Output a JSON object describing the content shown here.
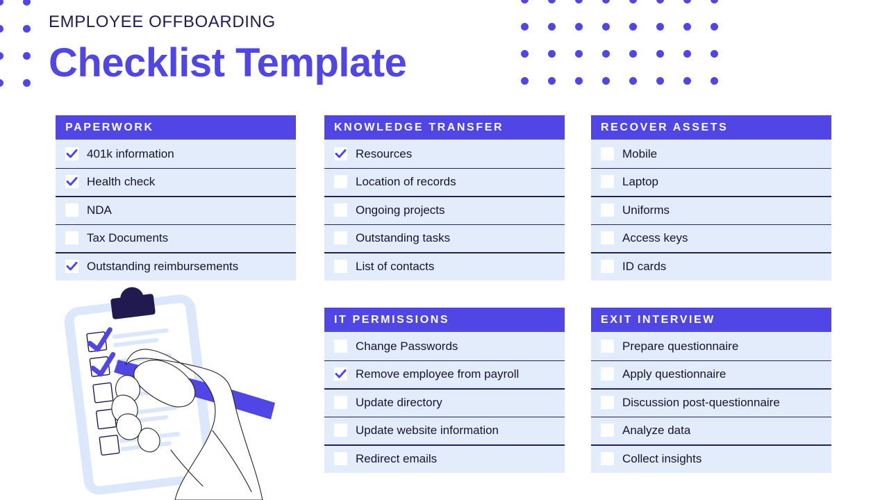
{
  "header": {
    "eyebrow": "EMPLOYEE OFFBOARDING",
    "title": "Checklist Template"
  },
  "colors": {
    "accent_purple": "#4f46e5",
    "row_background": "#e3ecfb",
    "row_divider": "#23215c",
    "header_text": "#ffffff",
    "eyebrow_text": "#201a54",
    "label_text": "#16142e",
    "illustration_light_blue": "#dbe7fb",
    "illustration_navy": "#211a50",
    "decor_dot": "#4f46e5"
  },
  "decor": {
    "left_dot_grid": {
      "columns": 2,
      "rows": 4
    },
    "right_dot_grid": {
      "columns": 8,
      "rows": 4
    }
  },
  "cards": [
    {
      "id": "paperwork",
      "title": "PAPERWORK",
      "items": [
        {
          "label": "401k information",
          "checked": true
        },
        {
          "label": "Health check",
          "checked": true
        },
        {
          "label": "NDA",
          "checked": false
        },
        {
          "label": "Tax Documents",
          "checked": false
        },
        {
          "label": "Outstanding reimbursements",
          "checked": true
        }
      ]
    },
    {
      "id": "knowledge-transfer",
      "title": "KNOWLEDGE TRANSFER",
      "items": [
        {
          "label": "Resources",
          "checked": true
        },
        {
          "label": "Location of records",
          "checked": false
        },
        {
          "label": "Ongoing projects",
          "checked": false
        },
        {
          "label": "Outstanding tasks",
          "checked": false
        },
        {
          "label": "List of contacts",
          "checked": false
        }
      ]
    },
    {
      "id": "recover-assets",
      "title": "RECOVER ASSETS",
      "items": [
        {
          "label": "Mobile",
          "checked": false
        },
        {
          "label": "Laptop",
          "checked": false
        },
        {
          "label": "Uniforms",
          "checked": false
        },
        {
          "label": "Access keys",
          "checked": false
        },
        {
          "label": "ID cards",
          "checked": false
        }
      ]
    },
    {
      "id": "it-permissions",
      "title": "IT PERMISSIONS",
      "items": [
        {
          "label": "Change Passwords",
          "checked": false
        },
        {
          "label": "Remove employee from payroll",
          "checked": true
        },
        {
          "label": "Update directory",
          "checked": false
        },
        {
          "label": "Update website information",
          "checked": false
        },
        {
          "label": "Redirect emails",
          "checked": false
        }
      ]
    },
    {
      "id": "exit-interview",
      "title": "EXIT INTERVIEW",
      "items": [
        {
          "label": "Prepare questionnaire",
          "checked": false
        },
        {
          "label": "Apply questionnaire",
          "checked": false
        },
        {
          "label": "Discussion post-questionnaire",
          "checked": false
        },
        {
          "label": "Analyze data",
          "checked": false
        },
        {
          "label": "Collect insights",
          "checked": false
        }
      ]
    }
  ],
  "illustration": {
    "name": "hand-checking-clipboard-illustration",
    "clipboard_checkboxes": [
      {
        "checked": true
      },
      {
        "checked": true
      },
      {
        "checked": false
      },
      {
        "checked": false
      },
      {
        "checked": false
      }
    ]
  }
}
